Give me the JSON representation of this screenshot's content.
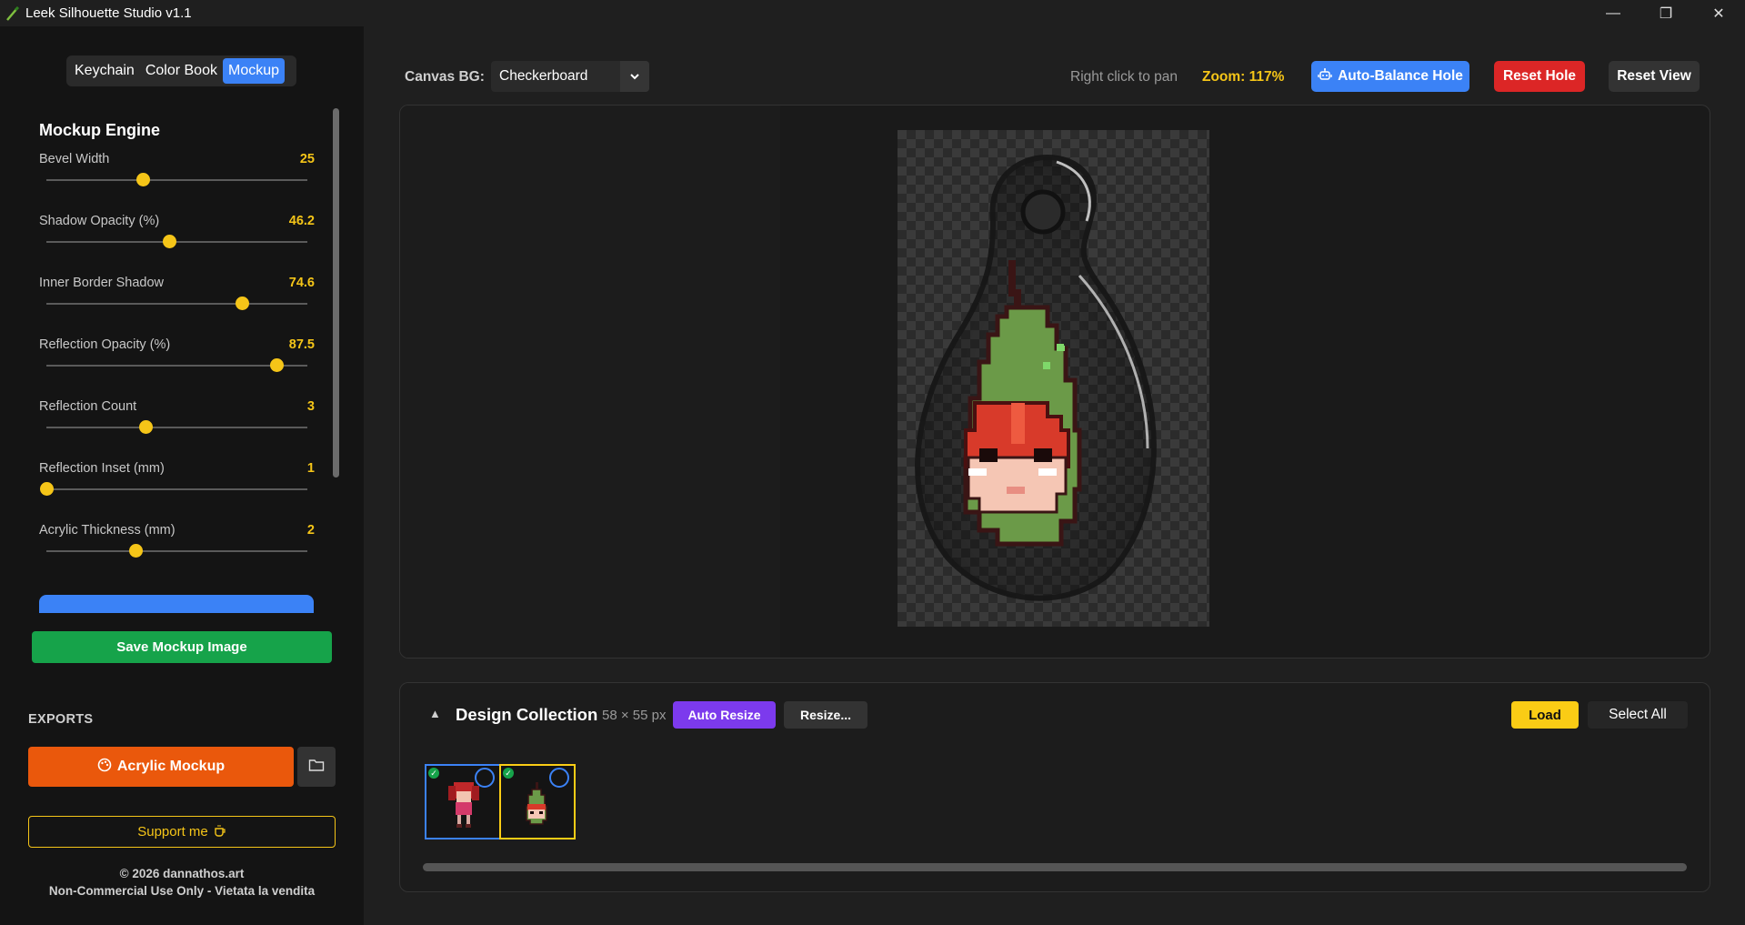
{
  "window": {
    "title": "Leek Silhouette Studio v1.1",
    "minimize_glyph": "—",
    "maximize_glyph": "❐",
    "close_glyph": "✕"
  },
  "mode_tabs": [
    {
      "label": "Keychain",
      "active": false
    },
    {
      "label": "Color Book",
      "active": false
    },
    {
      "label": "Mockup",
      "active": true
    }
  ],
  "engine": {
    "title": "Mockup Engine",
    "sliders": [
      {
        "label": "Bevel Width",
        "value": "25",
        "fraction": 0.37
      },
      {
        "label": "Shadow Opacity (%)",
        "value": "46.2",
        "fraction": 0.47
      },
      {
        "label": "Inner Border Shadow",
        "value": "74.6",
        "fraction": 0.75
      },
      {
        "label": "Reflection Opacity (%)",
        "value": "87.5",
        "fraction": 0.88
      },
      {
        "label": "Reflection Count",
        "value": "3",
        "fraction": 0.38
      },
      {
        "label": "Reflection Inset (mm)",
        "value": "1",
        "fraction": 0.0
      },
      {
        "label": "Acrylic Thickness (mm)",
        "value": "2",
        "fraction": 0.34
      }
    ]
  },
  "actions": {
    "save_mockup": "Save Mockup Image"
  },
  "exports": {
    "label": "EXPORTS",
    "acrylic_mockup": "Acrylic Mockup",
    "support": "Support me"
  },
  "footer": {
    "copyright": "© 2026 dannathos.art",
    "license": "Non-Commercial Use Only - Vietata la vendita"
  },
  "toolbar": {
    "canvas_bg_label": "Canvas BG:",
    "canvas_bg_value": "Checkerboard",
    "hint": "Right click to pan",
    "zoom": "Zoom: 117%",
    "auto_balance": "Auto-Balance Hole",
    "reset_hole": "Reset Hole",
    "reset_view": "Reset View"
  },
  "collection": {
    "title": "Design Collection",
    "size": "58 × 55 px",
    "auto_resize": "Auto Resize",
    "resize": "Resize...",
    "load": "Load",
    "select_all": "Select All",
    "collapse_glyph": "▲",
    "check_glyph": "✓"
  },
  "colors": {
    "accent_blue": "#3b82f6",
    "accent_yellow": "#f5c518",
    "green": "#16a34a",
    "orange": "#ea580c",
    "red": "#dc2626",
    "purple": "#7c3aed"
  }
}
